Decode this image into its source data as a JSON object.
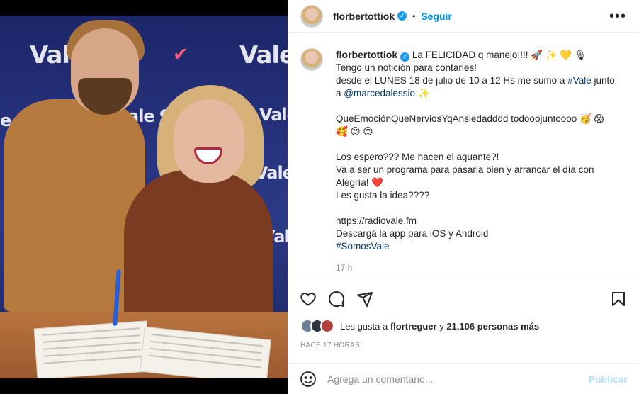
{
  "header": {
    "username": "florbertottiok",
    "separator": "•",
    "follow_label": "Seguir",
    "more_icon": "more-horizontal-icon"
  },
  "photo": {
    "backdrop_words": [
      "Vale",
      "Vale",
      "Vale",
      "ale 97",
      "Vale",
      "e 97",
      "Vale"
    ]
  },
  "caption": {
    "username": "florbertottiok",
    "line1": "La FELICIDAD q manejo!!!! 🚀 ✨ 💛 🎙",
    "line2": "Tengo un notición para contarles!",
    "line3_a": "desde el LUNES 18 de julio de 10 a 12 Hs me sumo a ",
    "line3_link": "#Vale",
    "line3_b": " junto",
    "line4_a": "a ",
    "line4_link": "@marcedalessio",
    "line4_b": " ✨",
    "line5": "QueEmociónQueNerviosYqAnsiedadddd todooojuntoooo 🥳 😱",
    "line6": "🥰 😍 😍",
    "line7": "Los espero??? Me hacen el aguante?!",
    "line8": "Va a ser un programa para pasarla bien y arrancar el día con",
    "line9": "Alegría! ❤️",
    "line10": "Les gusta la idea????",
    "line11": "https://radiovale.fm",
    "line12": "Descargá la app para iOS y Android",
    "line13": "#SomosVale",
    "timestamp": "17 h"
  },
  "actions": {
    "like_icon": "heart-icon",
    "comment_icon": "comment-icon",
    "share_icon": "share-icon",
    "save_icon": "bookmark-icon"
  },
  "likes": {
    "prefix": "Les gusta a ",
    "user": "flortreguer",
    "middle": " y ",
    "count": "21,106 personas más"
  },
  "time_ago": "HACE 17 HORAS",
  "comment": {
    "placeholder": "Agrega un comentario...",
    "publish_label": "Publicar"
  },
  "colors": {
    "link": "#00376b",
    "follow": "#0095f6",
    "publish_disabled": "#b2dffc",
    "verified": "#1d9bf0"
  }
}
